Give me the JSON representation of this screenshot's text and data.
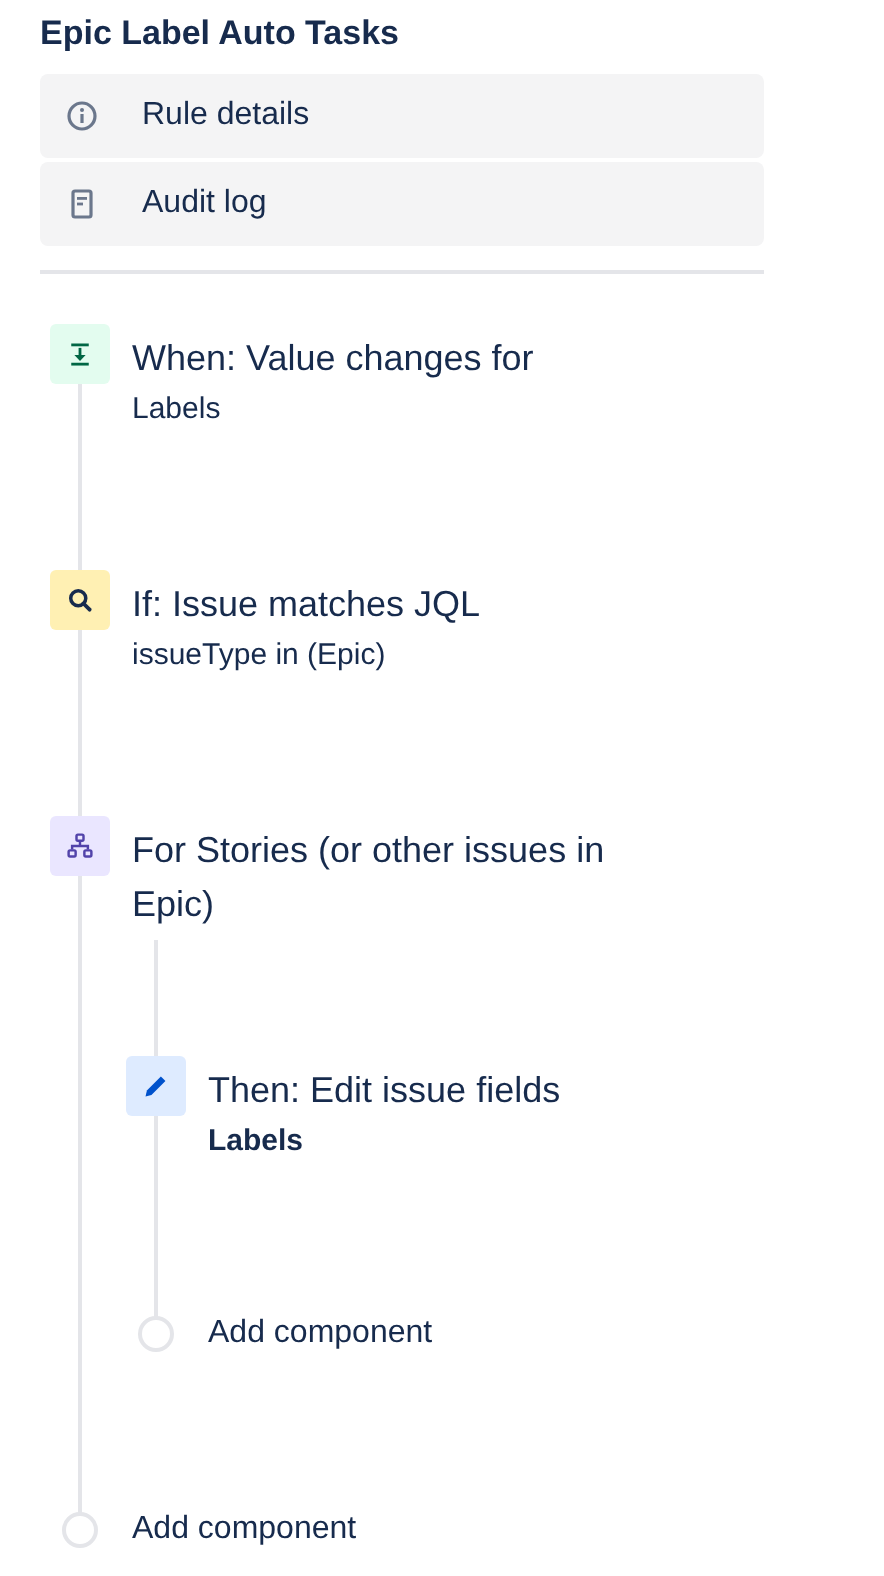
{
  "title": "Epic Label Auto Tasks",
  "menu": [
    {
      "kind": "info",
      "label": "Rule details"
    },
    {
      "kind": "log",
      "label": "Audit log"
    }
  ],
  "flow": [
    {
      "kind": "trigger",
      "title": "When: Value changes for",
      "detail": "Labels",
      "emphasis": false
    },
    {
      "kind": "condition",
      "title": "If: Issue matches JQL",
      "detail": "issueType in (Epic)",
      "emphasis": false
    },
    {
      "kind": "branch",
      "title": "For Stories (or other issues in Epic)",
      "children": [
        {
          "kind": "action",
          "title": "Then: Edit issue fields",
          "detail": "Labels",
          "emphasis": true
        },
        {
          "kind": "add",
          "title": "Add component"
        }
      ]
    },
    {
      "kind": "add",
      "title": "Add component"
    }
  ]
}
